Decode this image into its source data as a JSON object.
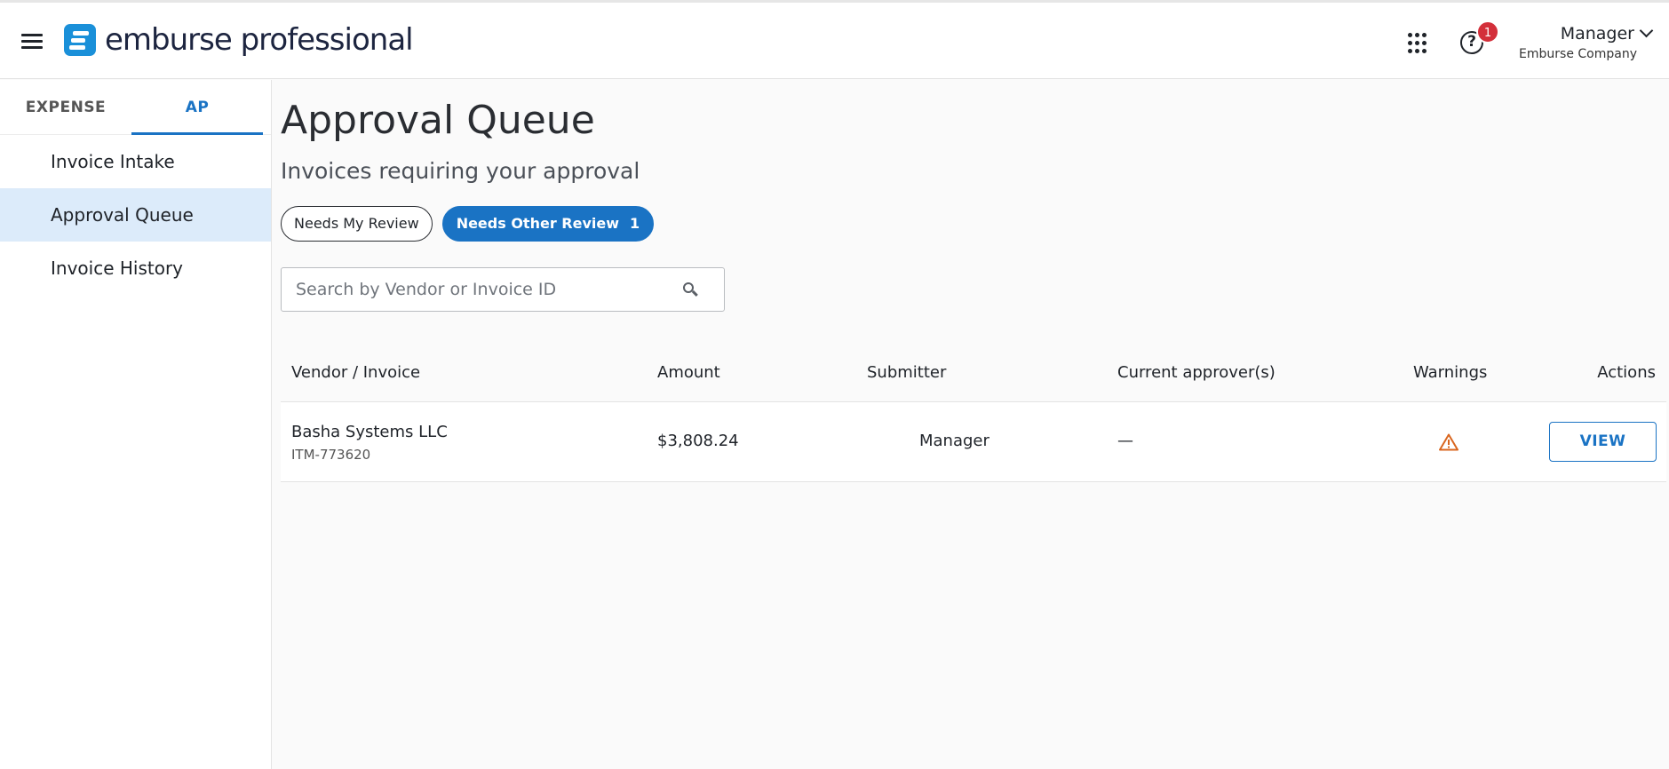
{
  "header": {
    "logo_text": "emburse professional",
    "help_badge_count": "1",
    "help_glyph": "?",
    "user_name": "Manager",
    "user_company": "Emburse Company"
  },
  "sidebar": {
    "tabs": [
      {
        "label": "EXPENSE",
        "active": false
      },
      {
        "label": "AP",
        "active": true
      }
    ],
    "items": [
      {
        "label": "Invoice Intake",
        "active": false
      },
      {
        "label": "Approval Queue",
        "active": true
      },
      {
        "label": "Invoice History",
        "active": false
      }
    ]
  },
  "main": {
    "title": "Approval Queue",
    "subtitle": "Invoices requiring your approval",
    "filters": [
      {
        "label": "Needs My Review",
        "selected": false
      },
      {
        "label": "Needs Other Review",
        "count": "1",
        "selected": true
      }
    ],
    "search": {
      "placeholder": "Search by Vendor or Invoice ID",
      "value": ""
    },
    "table": {
      "columns": [
        "Vendor / Invoice",
        "Amount",
        "Submitter",
        "Current approver(s)",
        "Warnings",
        "Actions"
      ],
      "rows": [
        {
          "vendor": "Basha Systems LLC",
          "invoice_id": "ITM-773620",
          "amount": "$3,808.24",
          "submitter": "Manager",
          "approver": "—",
          "warning_icon": "warning-triangle-icon",
          "action_label": "VIEW"
        }
      ]
    }
  },
  "colors": {
    "brand_blue": "#1a73c4",
    "logo_blue": "#1a90d9",
    "active_nav_bg": "#dcebfa",
    "badge_red": "#d32f3a",
    "warning_orange": "#d9661f"
  }
}
